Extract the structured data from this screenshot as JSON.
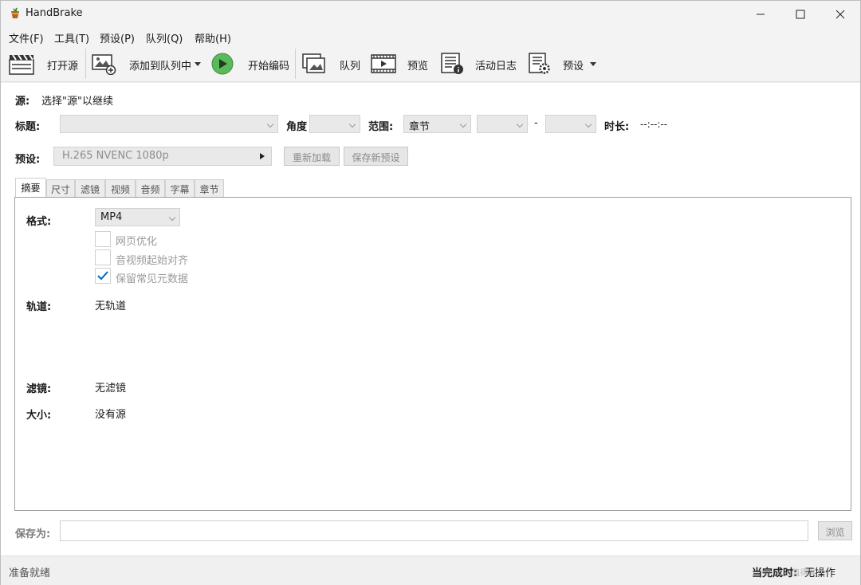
{
  "window": {
    "title": "HandBrake"
  },
  "menu": [
    "文件(F)",
    "工具(T)",
    "预设(P)",
    "队列(Q)",
    "帮助(H)"
  ],
  "toolbar": {
    "open_source": "打开源",
    "add_to_queue": "添加到队列中",
    "start_encode": "开始编码",
    "queue": "队列",
    "preview": "预览",
    "activity_log": "活动日志",
    "presets": "预设"
  },
  "source": {
    "label": "源:",
    "value": "选择\"源\"以继续"
  },
  "title_row": {
    "title_label": "标题:",
    "angle_label": "角度",
    "range_label": "范围:",
    "range_value": "章节",
    "range_sep": "-",
    "duration_label": "时长:",
    "duration_value": "--:--:--"
  },
  "preset_row": {
    "label": "预设:",
    "value": "H.265 NVENC 1080p",
    "reload": "重新加载",
    "save_new": "保存新预设"
  },
  "tabs": [
    "摘要",
    "尺寸",
    "滤镜",
    "视频",
    "音频",
    "字幕",
    "章节"
  ],
  "summary": {
    "format_label": "格式:",
    "format_value": "MP4",
    "opt_web": "网页优化",
    "opt_align": "音视频起始对齐",
    "opt_metadata": "保留常见元数据",
    "metadata_checked": true,
    "tracks_label": "轨道:",
    "tracks_value": "无轨道",
    "filters_label": "滤镜:",
    "filters_value": "无滤镜",
    "size_label": "大小:",
    "size_value": "没有源"
  },
  "save_as": {
    "label": "保存为:",
    "value": "",
    "browse": "浏览"
  },
  "status": {
    "left": "准备就绪",
    "right": "当完成时:",
    "right_value": "无操作"
  },
  "watermark": "值 什么值得买",
  "colors": {
    "play_green": "#5cb85c",
    "check_blue": "#0067c0"
  }
}
